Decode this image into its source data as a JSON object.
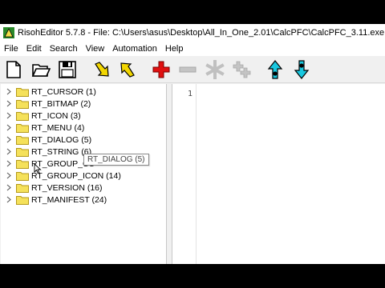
{
  "window": {
    "title": "RisohEditor 5.7.8 - File: C:\\Users\\asus\\Desktop\\All_In_One_2.01\\CalcPFC\\CalcPFC_3.11.exe"
  },
  "menu": [
    "File",
    "Edit",
    "Search",
    "View",
    "Automation",
    "Help"
  ],
  "toolbar": {
    "buttons": [
      {
        "name": "new-icon"
      },
      {
        "name": "open-icon"
      },
      {
        "name": "save-icon"
      },
      {
        "name": "import-arrow-icon"
      },
      {
        "name": "export-arrow-icon"
      },
      {
        "name": "add-icon"
      },
      {
        "name": "remove-icon"
      },
      {
        "name": "modify-icon"
      },
      {
        "name": "clone-icon"
      },
      {
        "name": "move-up-icon"
      },
      {
        "name": "move-down-icon"
      }
    ]
  },
  "tree": {
    "items": [
      "RT_CURSOR (1)",
      "RT_BITMAP (2)",
      "RT_ICON (3)",
      "RT_MENU (4)",
      "RT_DIALOG (5)",
      "RT_STRING (6)",
      "RT_GROUP_CU",
      "RT_GROUP_ICON (14)",
      "RT_VERSION (16)",
      "RT_MANIFEST (24)"
    ]
  },
  "tooltip": {
    "text": "RT_DIALOG (5)"
  },
  "editor": {
    "line_numbers": [
      "1"
    ]
  },
  "colors": {
    "folder": "#f5e15a",
    "folder_outline": "#b59a1a",
    "add_red": "#e01010",
    "nav_cyan": "#18c8e0"
  }
}
